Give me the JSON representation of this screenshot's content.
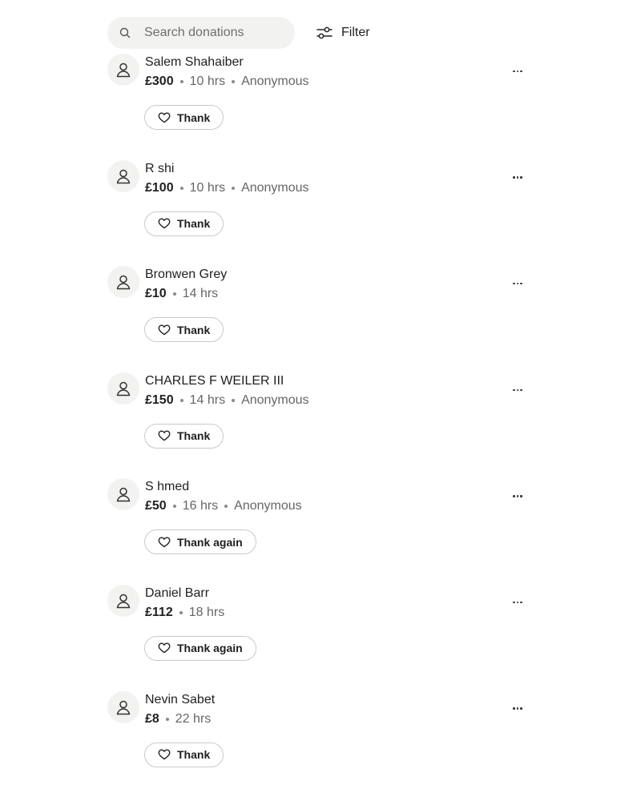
{
  "search": {
    "placeholder": "Search donations",
    "value": ""
  },
  "filter": {
    "label": "Filter"
  },
  "donations": [
    {
      "name": "Salem Shahaiber",
      "amount": "£300",
      "time": "10 hrs",
      "tag": "Anonymous",
      "action": "Thank"
    },
    {
      "name": "R            shi",
      "amount": "£100",
      "time": "10 hrs",
      "tag": "Anonymous",
      "action": "Thank"
    },
    {
      "name": "Bronwen Grey",
      "amount": "£10",
      "time": "14 hrs",
      "tag": "",
      "action": "Thank"
    },
    {
      "name": "CHARLES F WEILER III",
      "amount": "£150",
      "time": "14 hrs",
      "tag": "Anonymous",
      "action": "Thank"
    },
    {
      "name": "S      hmed",
      "amount": "£50",
      "time": "16 hrs",
      "tag": "Anonymous",
      "action": "Thank again"
    },
    {
      "name": "Daniel Barr",
      "amount": "£112",
      "time": "18 hrs",
      "tag": "",
      "action": "Thank again"
    },
    {
      "name": "Nevin Sabet",
      "amount": "£8",
      "time": "22 hrs",
      "tag": "",
      "action": "Thank"
    }
  ]
}
